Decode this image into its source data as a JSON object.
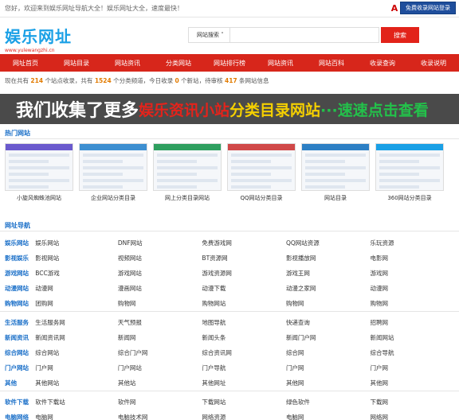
{
  "topbar": {
    "notice": "您好，欢迎来到娱乐网址导航大全！娱乐网址大全，速度最快！",
    "login_label": "免费收录网站登录",
    "a_icon": "A"
  },
  "logo": {
    "title": "娱乐网址",
    "url": "www.yulewangzhi.cn"
  },
  "search": {
    "scope": "网站搜索 ˅",
    "button": "搜索"
  },
  "nav": [
    "网址首页",
    "网站目录",
    "网站资讯",
    "分类网站",
    "网站排行榜",
    "网站资讯",
    "网站百科",
    "收录查询",
    "收录说明"
  ],
  "stats": {
    "prefix": "现在共有",
    "sites": "214",
    "mid1": "个站点收录，共有",
    "cats": "1524",
    "mid2": "个分类频道，今日收录",
    "today": "0",
    "mid3": "个新站，待审核",
    "pending": "417",
    "suffix": "条网站信息"
  },
  "banner": {
    "p1": "我们收集了更多",
    "p2": "娱乐资讯小站",
    "p3": "分类目录网站",
    "p4": "···速速点击查看"
  },
  "featured": {
    "title": "热门网站",
    "items": [
      {
        "caption": "小旋风蜘蛛池网站",
        "header_color": "#6a5acd"
      },
      {
        "caption": "企业网站分类目录",
        "header_color": "#3d8fd1"
      },
      {
        "caption": "网上分类目录网站",
        "header_color": "#2e9f5f"
      },
      {
        "caption": "QQ网站分类目录",
        "header_color": "#d04848"
      },
      {
        "caption": "网站目录",
        "header_color": "#2c7fc4"
      },
      {
        "caption": "360网站分类目录",
        "header_color": "#1aa0e6"
      }
    ]
  },
  "directory": {
    "title": "网址导航",
    "rows": [
      {
        "cat": "娱乐网站",
        "items": [
          "娱乐网站",
          "DNF网站",
          "免费游戏网",
          "QQ网站资源",
          "乐玩资源"
        ]
      },
      {
        "cat": "影视娱乐",
        "items": [
          "影视网站",
          "视频网站",
          "BT资源网",
          "影视播放网",
          "电影网"
        ]
      },
      {
        "cat": "游戏网站",
        "items": [
          "BCC游戏",
          "游戏网站",
          "游戏资源网",
          "游戏王网",
          "游戏网"
        ]
      },
      {
        "cat": "动漫网站",
        "items": [
          "动漫网",
          "漫画网站",
          "动漫下载",
          "动漫之家网",
          "动漫网"
        ]
      },
      {
        "cat": "购物网站",
        "items": [
          "团购网",
          "购物网",
          "购物网站",
          "购物网",
          "购物网"
        ]
      },
      {
        "cat": "生活服务",
        "items": [
          "生活服务网",
          "天气预报",
          "地图导航",
          "快递查询",
          "招聘网"
        ]
      },
      {
        "cat": "新闻资讯",
        "items": [
          "新闻资讯网",
          "新闻网",
          "新闻头条",
          "新闻门户网",
          "新闻网站"
        ]
      },
      {
        "cat": "综合网站",
        "items": [
          "综合网站",
          "综合门户网",
          "综合资讯网",
          "综合网",
          "综合导航"
        ]
      },
      {
        "cat": "门户网站",
        "items": [
          "门户网",
          "门户网站",
          "门户导航",
          "门户网",
          "门户网"
        ]
      },
      {
        "cat": "其他",
        "items": [
          "其他网站",
          "其他站",
          "其他网址",
          "其他网",
          "其他网"
        ]
      },
      {
        "cat": "软件下载",
        "items": [
          "软件下载站",
          "软件网",
          "下载网站",
          "绿色软件",
          "下载网"
        ]
      },
      {
        "cat": "电脑网络",
        "items": [
          "电脑网",
          "电脑技术网",
          "网络资源",
          "电脑网",
          "网络网"
        ]
      }
    ]
  }
}
